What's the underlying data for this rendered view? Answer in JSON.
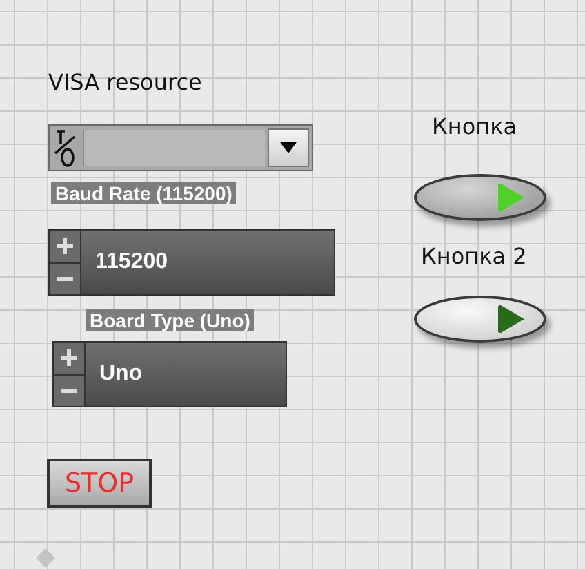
{
  "visa_resource": {
    "label": "VISA resource"
  },
  "baud_rate": {
    "label": "Baud Rate (115200)",
    "value": "115200"
  },
  "board_type": {
    "label": "Board Type (Uno)",
    "value": "Uno"
  },
  "buttons": [
    {
      "label": "Кнопка",
      "on": true
    },
    {
      "label": "Кнопка 2",
      "on": false
    }
  ],
  "stop_button": {
    "label": "STOP"
  }
}
